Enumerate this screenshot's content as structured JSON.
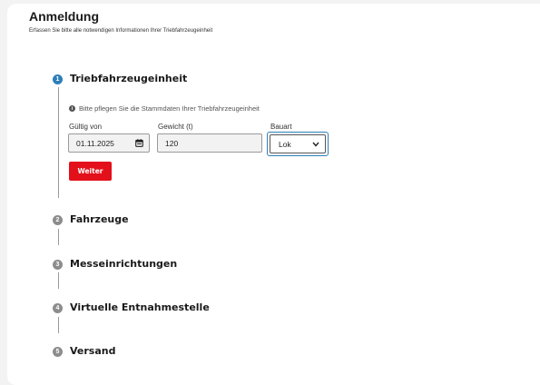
{
  "header": {
    "title": "Anmeldung",
    "subtitle": "Erfassen Sie bitte alle notwendigen Informationen Ihrer Triebfahrzeugeinheit"
  },
  "steps": [
    {
      "number": "1",
      "title": "Triebfahrzeugeinheit",
      "state": "active"
    },
    {
      "number": "2",
      "title": "Fahrzeuge",
      "state": "inactive"
    },
    {
      "number": "3",
      "title": "Messeinrichtungen",
      "state": "inactive"
    },
    {
      "number": "4",
      "title": "Virtuelle Entnahmestelle",
      "state": "inactive"
    },
    {
      "number": "5",
      "title": "Versand",
      "state": "inactive"
    }
  ],
  "form": {
    "info_icon": "info-icon",
    "info_text": "Bitte pflegen Sie die Stammdaten Ihrer Triebfahrzeugeinheit",
    "valid_from": {
      "label": "Gültig von",
      "value": "01.11.2025",
      "icon": "calendar-icon"
    },
    "weight": {
      "label": "Gewicht (t)",
      "value": "120"
    },
    "type": {
      "label": "Bauart",
      "value": "Lok",
      "icon": "chevron-down-icon"
    },
    "next_button": "Weiter"
  },
  "colors": {
    "active_step": "#2e7fb8",
    "inactive_step": "#8c8c8c",
    "primary_button": "#e3101b",
    "focus_border": "#2e7fb8"
  }
}
